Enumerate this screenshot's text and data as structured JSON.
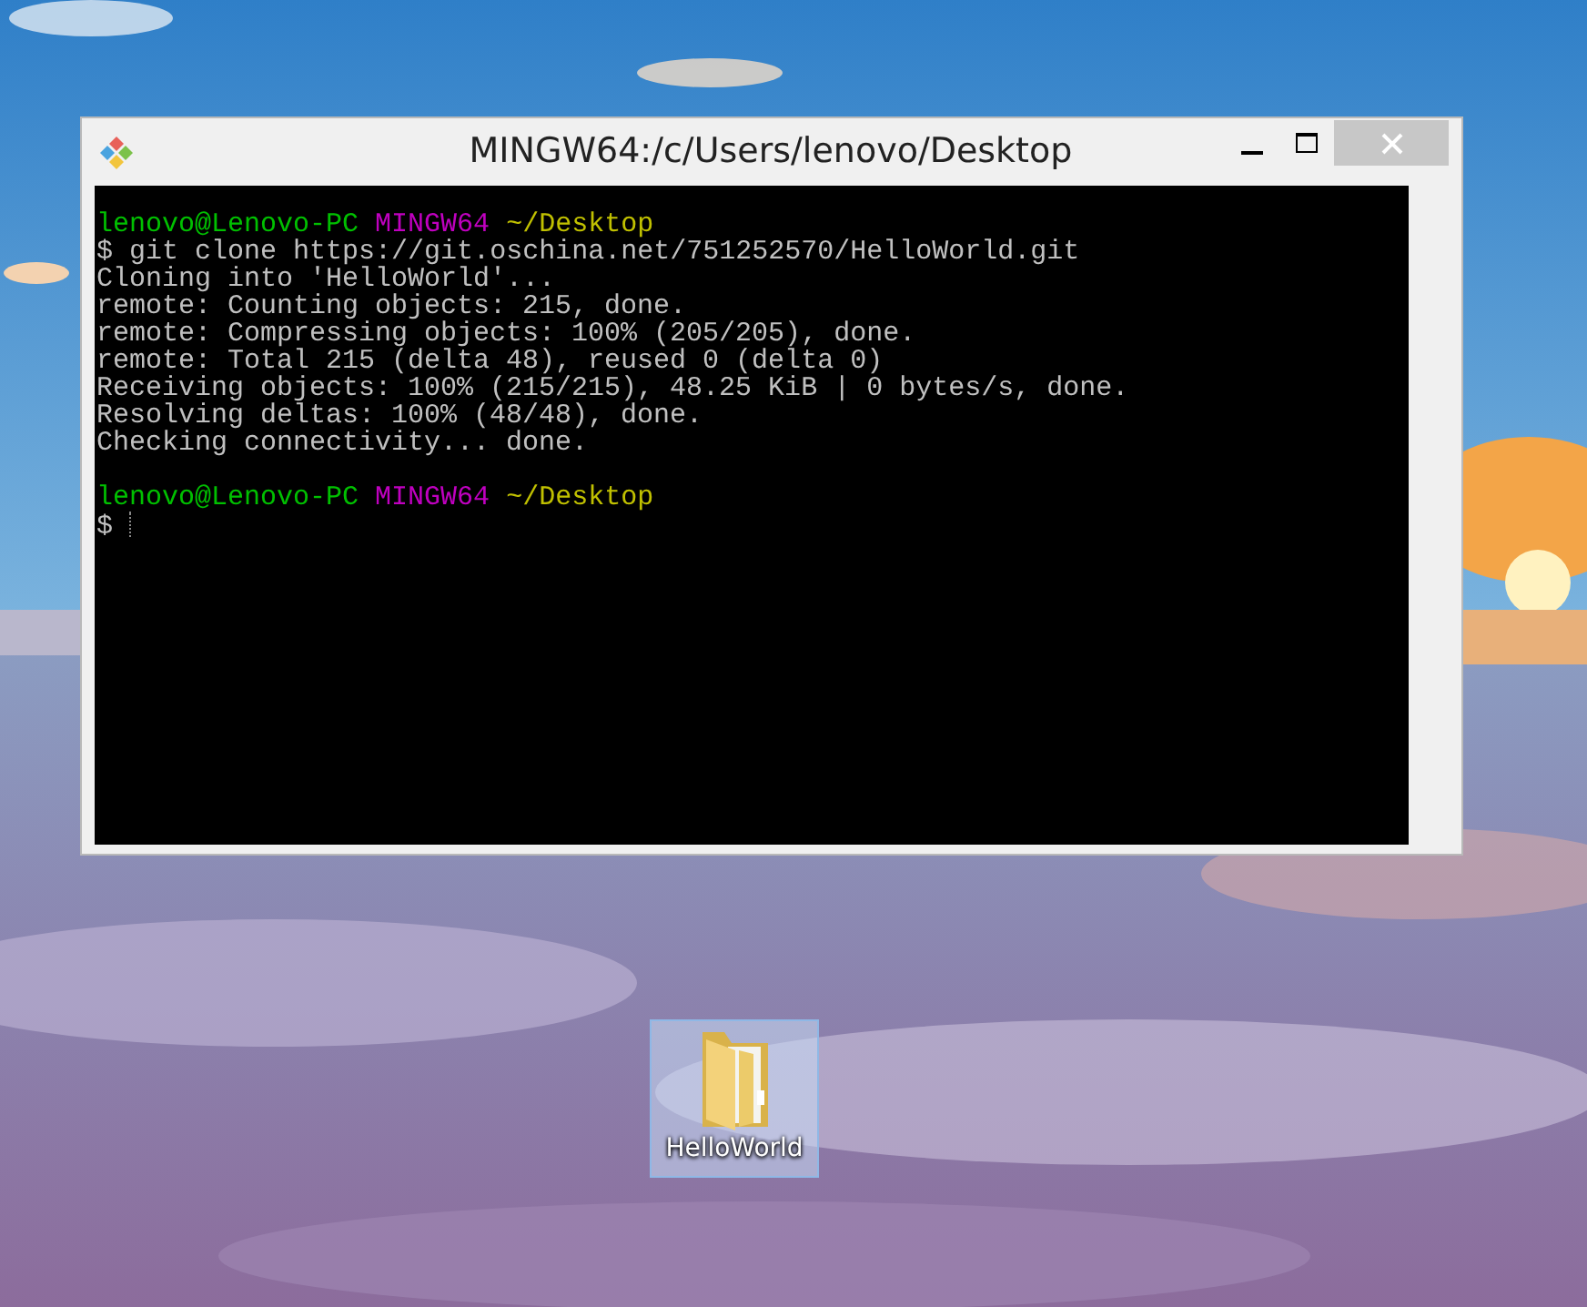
{
  "window": {
    "title": "MINGW64:/c/Users/lenovo/Desktop"
  },
  "terminal": {
    "lines": [
      {
        "kind": "prompt",
        "user": "lenovo@Lenovo-PC",
        "host": "MINGW64",
        "path": "~/Desktop"
      },
      {
        "kind": "input",
        "symbol": "$",
        "command": "git clone https://git.oschina.net/751252570/HelloWorld.git"
      },
      {
        "kind": "output",
        "text": "Cloning into 'HelloWorld'..."
      },
      {
        "kind": "output",
        "text": "remote: Counting objects: 215, done."
      },
      {
        "kind": "output",
        "text": "remote: Compressing objects: 100% (205/205), done."
      },
      {
        "kind": "output",
        "text": "remote: Total 215 (delta 48), reused 0 (delta 0)"
      },
      {
        "kind": "output",
        "text": "Receiving objects: 100% (215/215), 48.25 KiB | 0 bytes/s, done."
      },
      {
        "kind": "output",
        "text": "Resolving deltas: 100% (48/48), done."
      },
      {
        "kind": "output",
        "text": "Checking connectivity... done."
      },
      {
        "kind": "prompt",
        "user": "lenovo@Lenovo-PC",
        "host": "MINGW64",
        "path": "~/Desktop"
      },
      {
        "kind": "input",
        "symbol": "$",
        "cursor": true
      }
    ]
  },
  "desktop_icons": [
    {
      "label": "HelloWorld",
      "selected": true
    }
  ]
}
